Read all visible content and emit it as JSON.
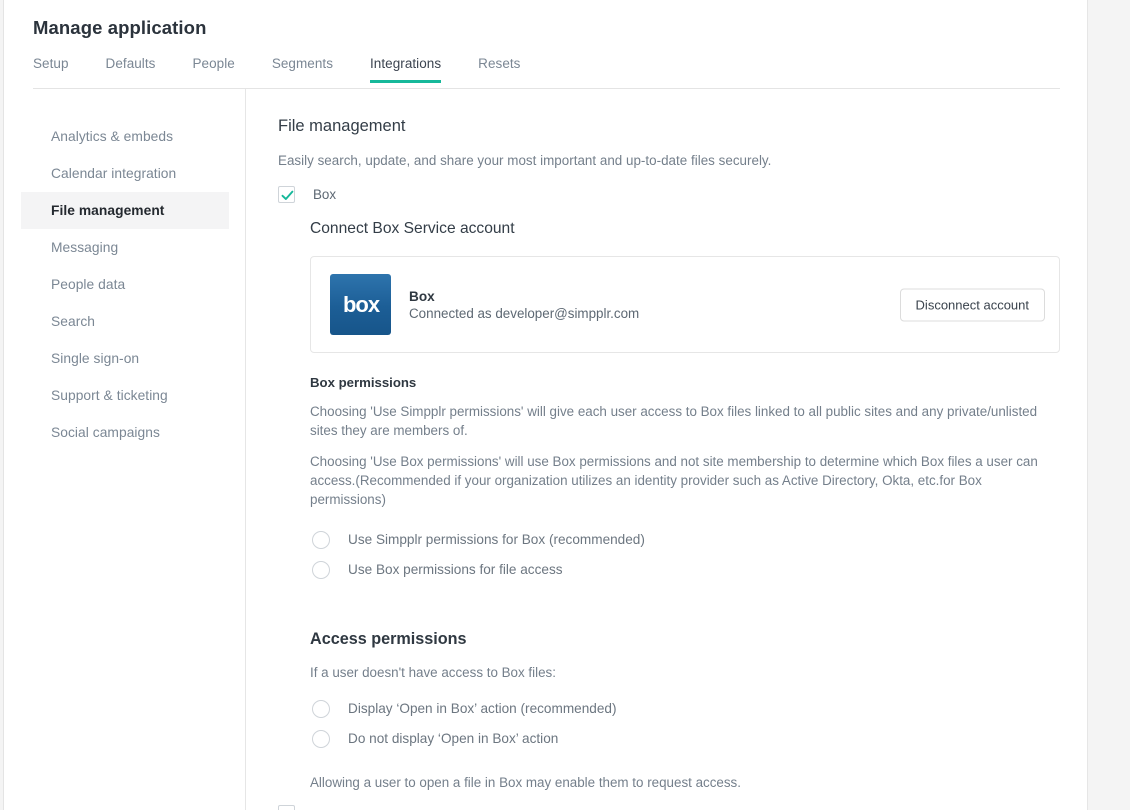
{
  "header": {
    "title": "Manage application",
    "tabs": [
      {
        "label": "Setup",
        "active": false
      },
      {
        "label": "Defaults",
        "active": false
      },
      {
        "label": "People",
        "active": false
      },
      {
        "label": "Segments",
        "active": false
      },
      {
        "label": "Integrations",
        "active": true
      },
      {
        "label": "Resets",
        "active": false
      }
    ],
    "active_tab_underline_color": "#16b89a"
  },
  "sidebar": {
    "items": [
      {
        "label": "Analytics & embeds",
        "active": false
      },
      {
        "label": "Calendar integration",
        "active": false
      },
      {
        "label": "File management",
        "active": true
      },
      {
        "label": "Messaging",
        "active": false
      },
      {
        "label": "People data",
        "active": false
      },
      {
        "label": "Search",
        "active": false
      },
      {
        "label": "Single sign-on",
        "active": false
      },
      {
        "label": "Support & ticketing",
        "active": false
      },
      {
        "label": "Social campaigns",
        "active": false
      }
    ]
  },
  "main": {
    "section_title": "File management",
    "section_subtitle": "Easily search, update, and share your most important and up-to-date files securely.",
    "box_toggle": {
      "label": "Box",
      "checked": true,
      "check_color": "#16b89a"
    },
    "connect_heading": "Connect Box Service account",
    "connection": {
      "logo_text": "box",
      "logo_color": "#1c5e96",
      "name": "Box",
      "status": "Connected as developer@simpplr.com",
      "disconnect_label": "Disconnect account"
    },
    "box_permissions": {
      "heading": "Box permissions",
      "paragraph_1": "Choosing 'Use Simpplr permissions' will give each user access to Box files linked to all public sites and any private/unlisted sites they are members of.",
      "paragraph_2": "Choosing 'Use Box permissions' will use Box permissions and not site membership to determine which Box files a user can access.(Recommended if your organization utilizes an identity provider such as Active Directory, Okta, etc.for Box permissions)",
      "options": [
        {
          "label": "Use Simpplr permissions for Box (recommended)",
          "selected": false
        },
        {
          "label": "Use Box permissions for file access",
          "selected": false
        }
      ]
    },
    "access_permissions": {
      "heading": "Access permissions",
      "intro": "If a user doesn't have access to Box files:",
      "options": [
        {
          "label": "Display ‘Open in Box’ action (recommended)",
          "selected": false
        },
        {
          "label": "Do not display ‘Open in Box’ action",
          "selected": false
        }
      ],
      "note": "Allowing a user to open a file in Box may enable them to request access."
    }
  }
}
